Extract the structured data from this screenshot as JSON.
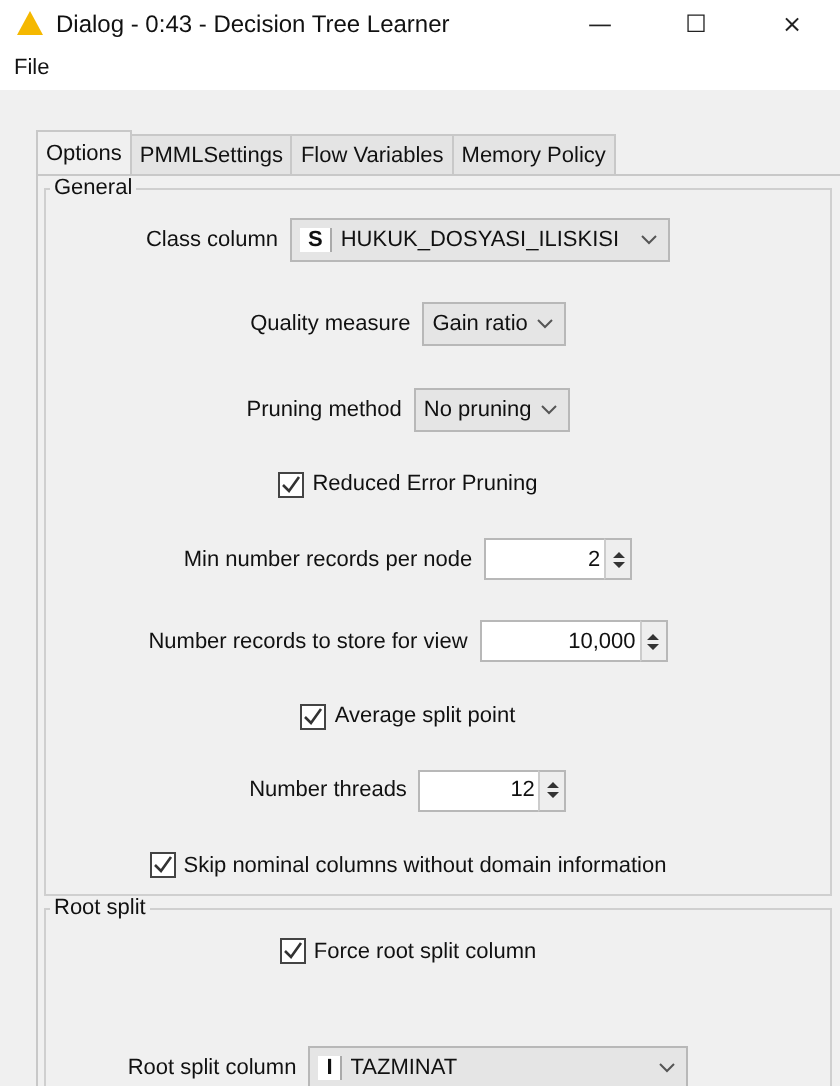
{
  "window": {
    "title": "Dialog - 0:43 - Decision Tree Learner",
    "controls": [
      "—",
      "☐",
      "×"
    ]
  },
  "menu": [
    "File"
  ],
  "tabs": [
    {
      "label": "Options",
      "selected": true
    },
    {
      "label": "PMMLSettings",
      "selected": false
    },
    {
      "label": "Flow Variables",
      "selected": false
    },
    {
      "label": "Memory Policy",
      "selected": false
    }
  ],
  "groups": [
    {
      "title": "General",
      "rows": [
        {
          "kind": "combo",
          "label": "Class column",
          "badge": "S",
          "value": "HUKUK_DOSYASI_ILISKISI"
        },
        {
          "kind": "combo",
          "label": "Quality measure",
          "value": "Gain ratio"
        },
        {
          "kind": "combo",
          "label": "Pruning method",
          "value": "No pruning"
        },
        {
          "kind": "checkbox",
          "label": "Reduced Error Pruning",
          "checked": true
        },
        {
          "kind": "spinner",
          "label": "Min number records per node",
          "value": "2"
        },
        {
          "kind": "spinner",
          "label": "Number records to store for view",
          "value": "10,000"
        },
        {
          "kind": "checkbox",
          "label": "Average split point",
          "checked": true
        },
        {
          "kind": "spinner",
          "label": "Number threads",
          "value": "12"
        },
        {
          "kind": "checkbox",
          "label": "Skip nominal columns without domain information",
          "checked": true
        }
      ]
    },
    {
      "title": "Root split",
      "rows": [
        {
          "kind": "checkbox",
          "label": "Force root split column",
          "checked": true
        },
        {
          "kind": "combo",
          "label": "Root split column",
          "badge": "I",
          "value": "TAZMINAT"
        }
      ]
    }
  ]
}
